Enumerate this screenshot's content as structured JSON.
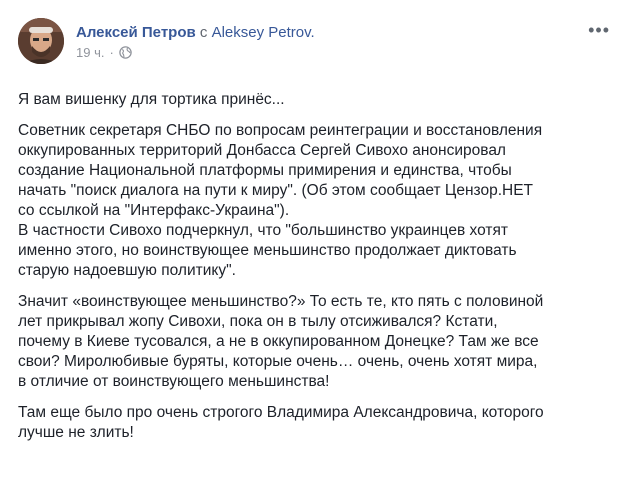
{
  "post": {
    "author": "Алексей Петров",
    "with_text": "с",
    "page_name": "Aleksey Petrov.",
    "timestamp": "19 ч.",
    "separator": "·",
    "more_label": "•••",
    "paragraphs": [
      "Я вам вишенку для тортика принёс...",
      "Советник секретаря СНБО по вопросам реинтеграции и восстановления\nоккупированных территорий Донбасса Сергей Сивохо анонсировал\nсоздание Национальной платформы примирения и единства, чтобы\nначать \"поиск диалога на пути к миру\". (Об этом сообщает Цензор.НЕТ\nсо ссылкой на \"Интерфакс-Украина\").\nВ частности Сивохо подчеркнул, что \"большинство украинцев хотят\nименно этого, но воинствующее меньшинство продолжает диктовать\nстарую надоевшую политику\".",
      "Значит «воинствующее меньшинство?» То есть те, кто пять с половиной\nлет прикрывал жопу Сивохи, пока он в тылу отсиживался? Кстати,\nпочему в Киеве тусовался, а не в оккупированном Донецке? Там же все\nсвои? Миролюбивые буряты, которые очень… очень, очень хотят мира,\nв отличие от воинствующего меньшинства!",
      "Там еще было про очень строгого Владимира Александровича, которого\nлучше не злить!"
    ]
  },
  "colors": {
    "link": "#385898",
    "text": "#1d2129",
    "meta": "#90949c"
  },
  "icons": {
    "privacy": "globe-icon"
  }
}
